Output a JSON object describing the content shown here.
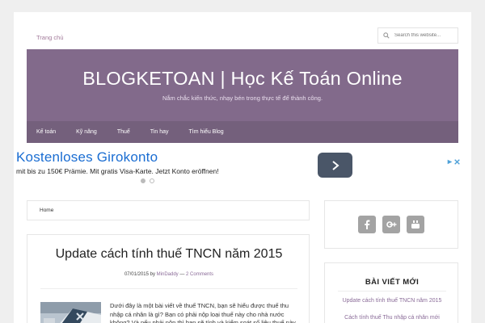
{
  "topnav": {
    "home": "Trang chủ"
  },
  "search": {
    "placeholder": "Search this website..."
  },
  "header": {
    "title": "BLOGKETOAN | Học Kế Toán Online",
    "description": "Nắm chắc kiến thức, nhạy bén trong thực tế để thành công."
  },
  "mainnav": {
    "items": [
      "Kế toán",
      "Kỹ năng",
      "Thuế",
      "Tin hay",
      "Tìm hiểu Blog"
    ]
  },
  "ad": {
    "title": "Kostenloses Girokonto",
    "text": "mit bis zu 150€ Prämie. Mit gratis Visa-Karte. Jetzt Konto eröffnen!"
  },
  "breadcrumb": {
    "home": "Home"
  },
  "post": {
    "title": "Update cách tính thuế TNCN năm 2015",
    "date": "07/01/2015",
    "by": "by",
    "author": "MinDaddy",
    "separator": "—",
    "comments": "2 Comments",
    "excerpt": "Dưới đây là một bài viết về thuế TNCN, bạn sẽ hiểu được thuế thu nhập cá nhân là gì? Bạn có phải nộp loại thuế này cho nhà nước không? Và nếu phải nộp thì bạn sẽ tính và kiểm soát số liệu thuế này"
  },
  "social": {
    "icons": [
      "facebook-icon",
      "google-plus-icon",
      "youtube-icon"
    ]
  },
  "recent": {
    "title": "BÀI VIẾT MỚI",
    "items": [
      "Update cách tính thuế TNCN năm 2015",
      "Cách tính thuế Thu nhập cá nhân mới"
    ]
  },
  "colors": {
    "banner": "#826a8b",
    "nav": "#74607c",
    "link": "#8a6b98",
    "ad_link": "#1a6dd2"
  }
}
